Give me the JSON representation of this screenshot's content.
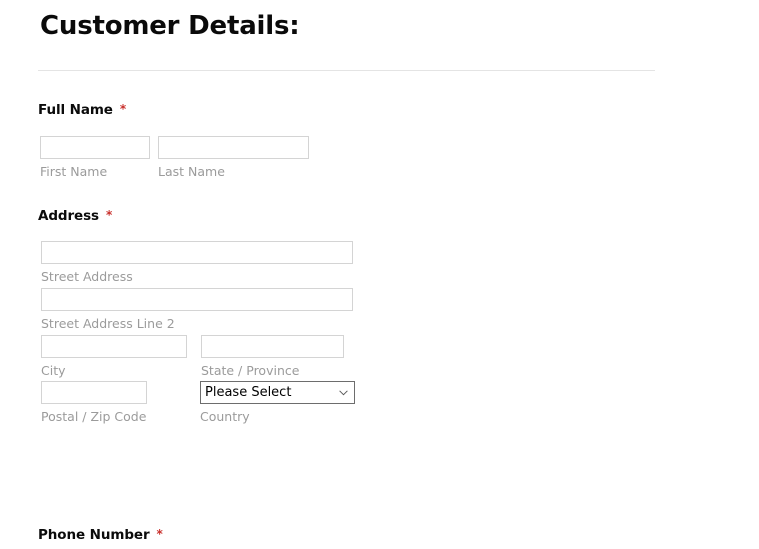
{
  "form": {
    "title": "Customer Details:",
    "required_marker": "*",
    "sections": [
      {
        "id": "full-name",
        "label": "Full Name",
        "required": true,
        "rows": [
          [
            {
              "id": "first-name",
              "sublabel": "First Name",
              "value": "",
              "placeholder": ""
            },
            {
              "id": "last-name",
              "sublabel": "Last Name",
              "value": "",
              "placeholder": ""
            }
          ]
        ]
      },
      {
        "id": "address",
        "label": "Address",
        "required": true,
        "rows": [
          [
            {
              "id": "street-address",
              "sublabel": "Street Address",
              "value": "",
              "placeholder": ""
            }
          ],
          [
            {
              "id": "street-address-line-2",
              "sublabel": "Street Address Line 2",
              "value": "",
              "placeholder": ""
            }
          ],
          [
            {
              "id": "city",
              "sublabel": "City",
              "value": "",
              "placeholder": ""
            },
            {
              "id": "state",
              "sublabel": "State / Province",
              "value": "",
              "placeholder": ""
            }
          ],
          [
            {
              "id": "postal-code",
              "sublabel": "Postal / Zip Code",
              "value": "",
              "placeholder": ""
            },
            {
              "id": "country",
              "sublabel": "Country",
              "selected": "Please Select",
              "options": [
                "Please Select"
              ],
              "icon": "chevron-down-icon"
            }
          ]
        ]
      },
      {
        "id": "phone-number",
        "label": "Phone Number",
        "required": true,
        "rows": []
      }
    ]
  },
  "colors": {
    "required_star": "#c9302c",
    "sublabel_text": "#9b9b9b",
    "label_text": "#0b0b0b",
    "input_border": "#d4d4d4",
    "select_border": "#6d6d6d",
    "divider": "#e4e4e4",
    "background": "#ffffff"
  }
}
